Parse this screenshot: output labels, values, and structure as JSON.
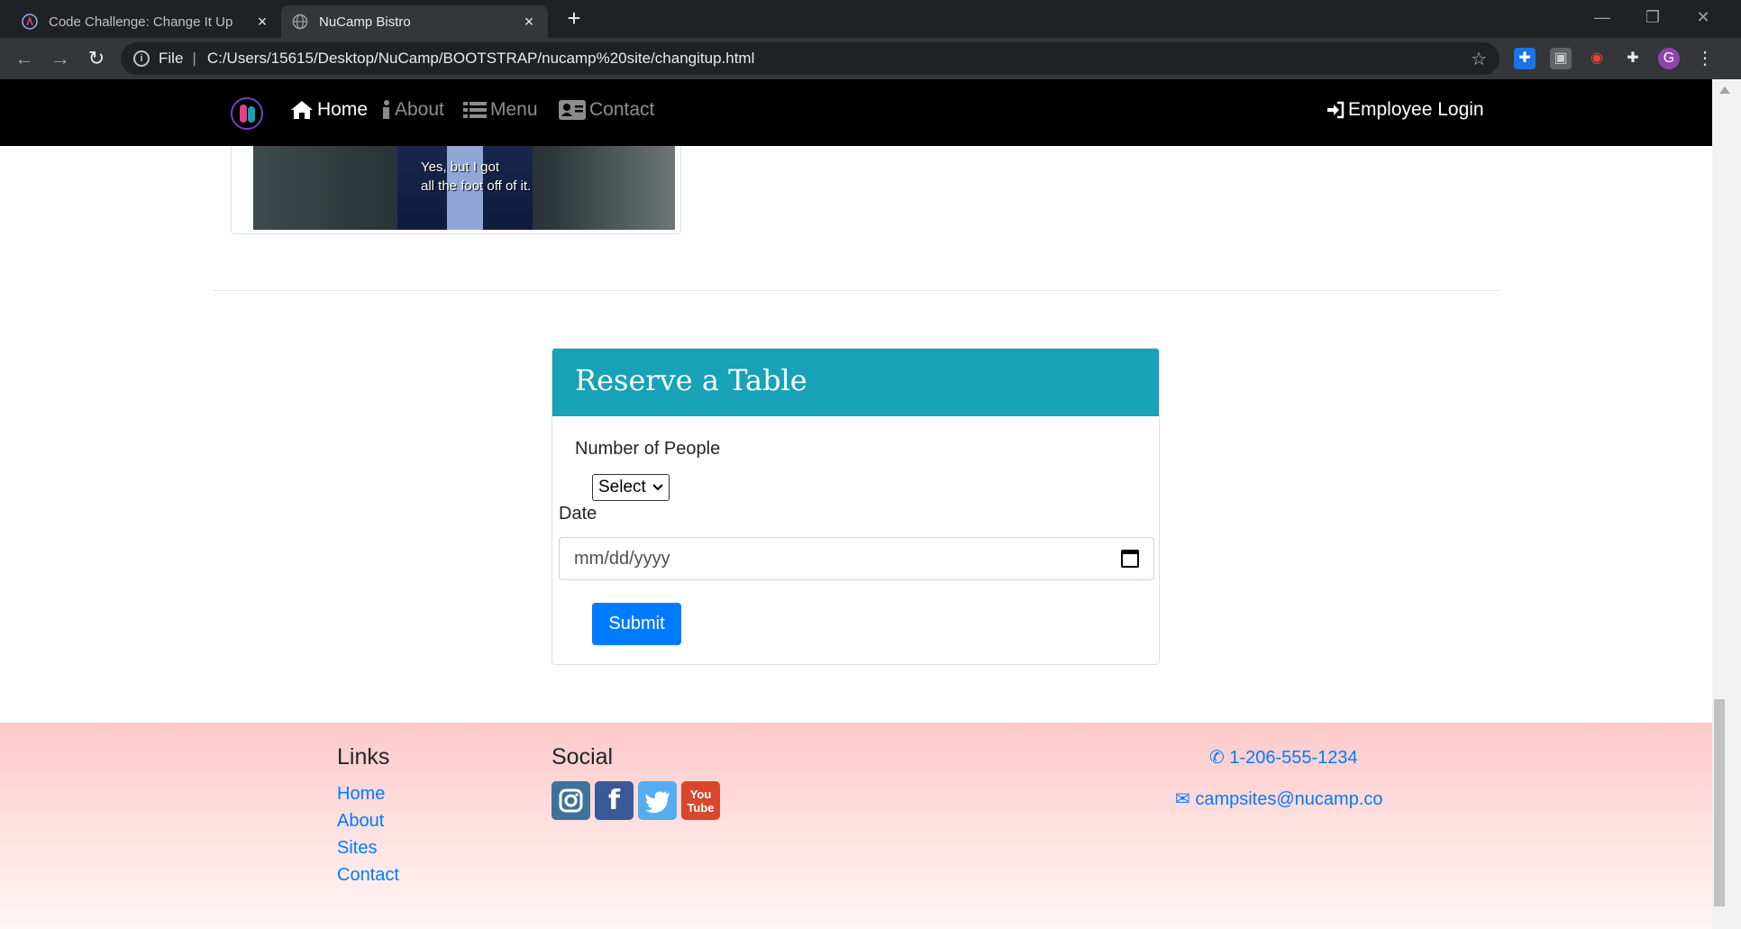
{
  "browser": {
    "tabs": [
      {
        "title": "Code Challenge: Change It Up",
        "active": false
      },
      {
        "title": "NuCamp Bistro",
        "active": true
      }
    ],
    "address_scheme": "File",
    "url": "C:/Users/15615/Desktop/NuCamp/BOOTSTRAP/nucamp%20site/changitup.html",
    "profile_initial": "G"
  },
  "navbar": {
    "items": [
      {
        "label": "Home",
        "icon": "home-icon",
        "active": true
      },
      {
        "label": "About",
        "icon": "info-icon",
        "active": false
      },
      {
        "label": "Menu",
        "icon": "list-icon",
        "active": false
      },
      {
        "label": "Contact",
        "icon": "address-card-icon",
        "active": false
      }
    ],
    "login_label": "Employee Login"
  },
  "image_caption": {
    "line1": "Yes, but I got",
    "line2": "all the foot off of it."
  },
  "reserve": {
    "title": "Reserve a Table",
    "people_label": "Number of People",
    "people_select_value": "Select",
    "date_label": "Date",
    "date_placeholder": "mm/dd/yyyy",
    "submit_label": "Submit"
  },
  "footer": {
    "links_heading": "Links",
    "links": [
      "Home",
      "About",
      "Sites",
      "Contact"
    ],
    "social_heading": "Social",
    "social": [
      {
        "name": "instagram-icon",
        "color": "#3f729b"
      },
      {
        "name": "facebook-icon",
        "color": "#3b5998"
      },
      {
        "name": "twitter-icon",
        "color": "#55acee"
      },
      {
        "name": "youtube-icon",
        "color": "#d9462b"
      }
    ],
    "phone": "1-206-555-1234",
    "email": "campsites@nucamp.co"
  }
}
